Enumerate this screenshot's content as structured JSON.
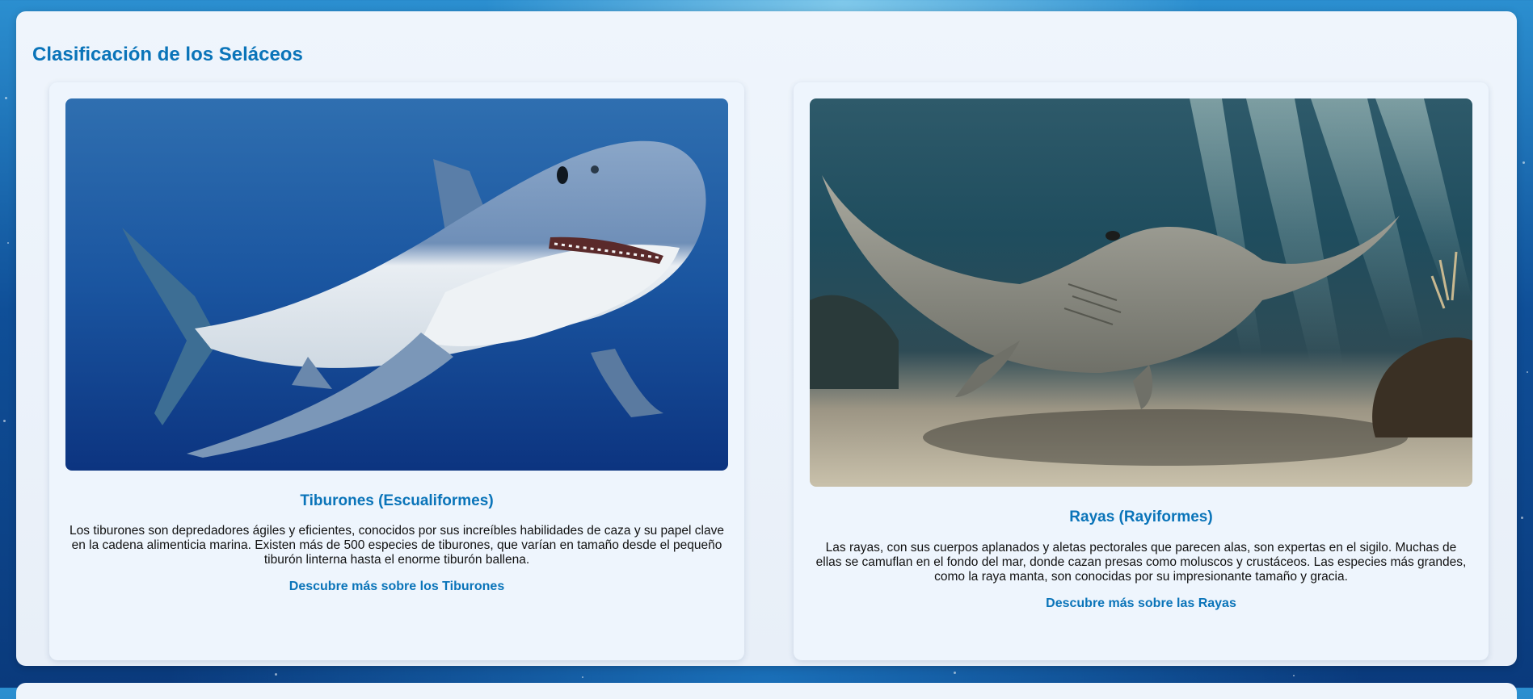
{
  "section": {
    "title": "Clasificación de los Seláceos"
  },
  "cards": [
    {
      "title": "Tiburones (Escualiformes)",
      "description": "Los tiburones son depredadores ágiles y eficientes, conocidos por sus increíbles habilidades de caza y su papel clave en la cadena alimenticia marina. Existen más de 500 especies de tiburones, que varían en tamaño desde el pequeño tiburón linterna hasta el enorme tiburón ballena.",
      "link_label": "Descubre más sobre los Tiburones",
      "image": "great-white-shark-photo"
    },
    {
      "title": "Rayas (Rayiformes)",
      "description": "Las rayas, con sus cuerpos aplanados y aletas pectorales que parecen alas, son expertas en el sigilo. Muchas de ellas se camuflan en el fondo del mar, donde cazan presas como moluscos y crustáceos. Las especies más grandes, como la raya manta, son conocidas por su impresionante tamaño y gracia.",
      "link_label": "Descubre más sobre las Rayas",
      "image": "stingray-seafloor-photo"
    }
  ],
  "colors": {
    "accent": "#0a74b9",
    "card_bg": "#eef5fd",
    "page_bg": "#0f4f98"
  }
}
